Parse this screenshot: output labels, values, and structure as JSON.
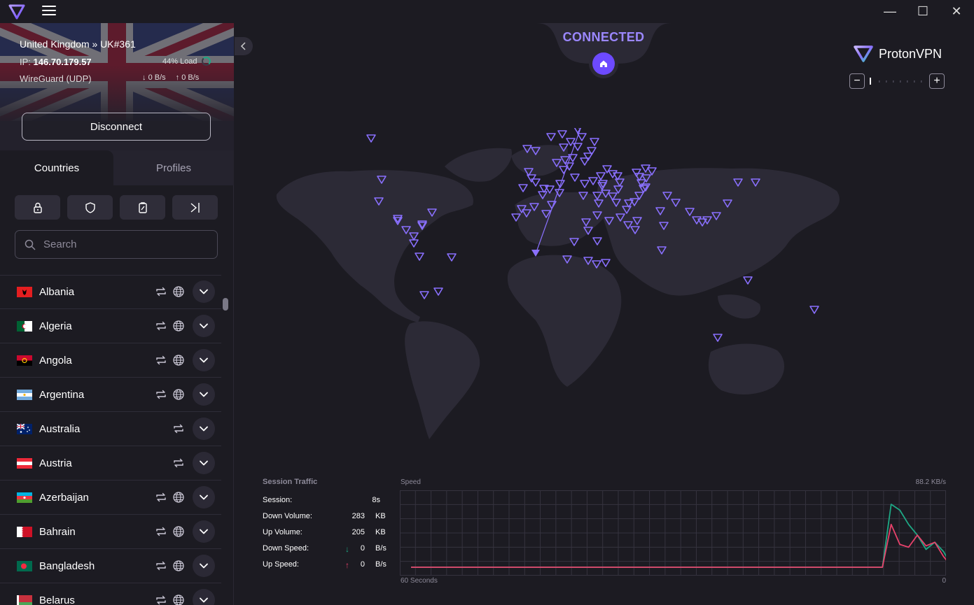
{
  "window": {
    "minimize": "—",
    "maximize": "☐",
    "close": "✕"
  },
  "connection": {
    "server": "United Kingdom » UK#361",
    "ip_label": "IP:",
    "ip": "146.70.179.57",
    "load": "44% Load",
    "protocol": "WireGuard (UDP)",
    "down_rate": "0 B/s",
    "up_rate": "0 B/s",
    "disconnect_label": "Disconnect"
  },
  "tabs": {
    "countries": "Countries",
    "profiles": "Profiles"
  },
  "search": {
    "placeholder": "Search"
  },
  "countries": [
    {
      "name": "Albania",
      "flag": "albania",
      "icons": [
        "p2p",
        "tor"
      ]
    },
    {
      "name": "Algeria",
      "flag": "algeria",
      "icons": [
        "p2p",
        "tor"
      ]
    },
    {
      "name": "Angola",
      "flag": "angola",
      "icons": [
        "p2p",
        "tor"
      ]
    },
    {
      "name": "Argentina",
      "flag": "argentina",
      "icons": [
        "p2p",
        "tor"
      ]
    },
    {
      "name": "Australia",
      "flag": "australia",
      "icons": [
        "p2p"
      ]
    },
    {
      "name": "Austria",
      "flag": "austria",
      "icons": [
        "p2p"
      ]
    },
    {
      "name": "Azerbaijan",
      "flag": "azerbaijan",
      "icons": [
        "p2p",
        "tor"
      ]
    },
    {
      "name": "Bahrain",
      "flag": "bahrain",
      "icons": [
        "p2p",
        "tor"
      ]
    },
    {
      "name": "Bangladesh",
      "flag": "bangladesh",
      "icons": [
        "p2p",
        "tor"
      ]
    },
    {
      "name": "Belarus",
      "flag": "belarus",
      "icons": [
        "p2p",
        "tor"
      ]
    }
  ],
  "map": {
    "status": "CONNECTED",
    "brand": "ProtonVPN",
    "zoom_out": "−",
    "zoom_in": "+"
  },
  "traffic": {
    "title": "Session Traffic",
    "rows": [
      {
        "label": "Session:",
        "value": "8s",
        "unit": ""
      },
      {
        "label": "Down Volume:",
        "value": "283",
        "unit": "KB"
      },
      {
        "label": "Up Volume:",
        "value": "205",
        "unit": "KB"
      },
      {
        "label": "Down Speed:",
        "value": "0",
        "unit": "B/s"
      },
      {
        "label": "Up Speed:",
        "value": "0",
        "unit": "B/s"
      }
    ]
  },
  "speed_chart": {
    "label": "Speed",
    "max_label": "88.2  KB/s",
    "x_left": "60 Seconds",
    "x_right": "0",
    "colors": {
      "down": "#1ea885",
      "up": "#e8426b",
      "grid": "#35333f"
    }
  },
  "chart_data": {
    "type": "line",
    "x": [
      60,
      59,
      58,
      57,
      56,
      55,
      54,
      53,
      52,
      51,
      50,
      49,
      48,
      47,
      46,
      45,
      44,
      43,
      42,
      41,
      40,
      39,
      38,
      37,
      36,
      35,
      34,
      33,
      32,
      31,
      30,
      29,
      28,
      27,
      26,
      25,
      24,
      23,
      22,
      21,
      20,
      19,
      18,
      17,
      16,
      15,
      14,
      13,
      12,
      11,
      10,
      9,
      8,
      7,
      6,
      5,
      4,
      3,
      2,
      1,
      0
    ],
    "series": [
      {
        "name": "Down",
        "values": [
          0,
          0,
          0,
          0,
          0,
          0,
          0,
          0,
          0,
          0,
          0,
          0,
          0,
          0,
          0,
          0,
          0,
          0,
          0,
          0,
          0,
          0,
          0,
          0,
          0,
          0,
          0,
          0,
          0,
          0,
          0,
          0,
          0,
          0,
          0,
          0,
          0,
          0,
          0,
          0,
          0,
          0,
          0,
          0,
          0,
          0,
          0,
          0,
          0,
          0,
          0,
          0,
          0,
          0,
          0,
          88.2,
          80,
          60,
          45,
          25,
          35,
          22,
          0
        ]
      },
      {
        "name": "Up",
        "values": [
          0,
          0,
          0,
          0,
          0,
          0,
          0,
          0,
          0,
          0,
          0,
          0,
          0,
          0,
          0,
          0,
          0,
          0,
          0,
          0,
          0,
          0,
          0,
          0,
          0,
          0,
          0,
          0,
          0,
          0,
          0,
          0,
          0,
          0,
          0,
          0,
          0,
          0,
          0,
          0,
          0,
          0,
          0,
          0,
          0,
          0,
          0,
          0,
          0,
          0,
          0,
          0,
          0,
          0,
          0,
          60,
          32,
          28,
          45,
          30,
          35,
          15,
          0
        ]
      }
    ],
    "xlabel": "",
    "ylabel": "",
    "ylim": [
      0,
      100
    ]
  }
}
